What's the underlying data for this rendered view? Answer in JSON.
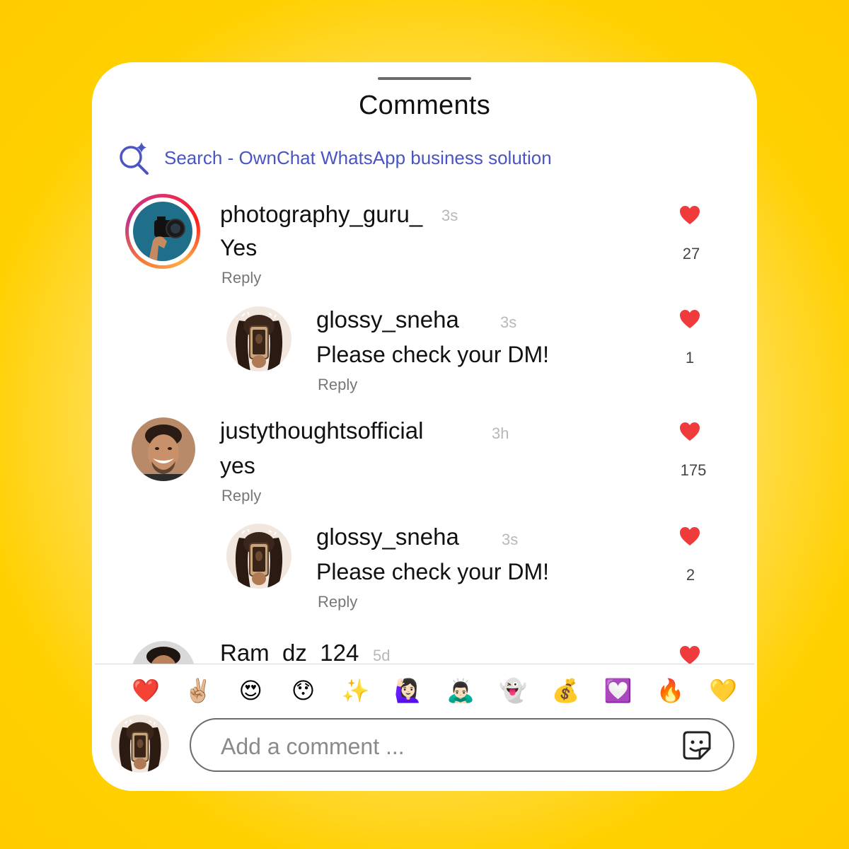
{
  "header": {
    "title": "Comments",
    "search_label": "Search - OwnChat WhatsApp business solution"
  },
  "colors": {
    "background": "#ffcc00",
    "search_accent": "#4a55c4",
    "heart": "#ef3b3b"
  },
  "comments": [
    {
      "username": "photography_guru_",
      "time": "3s",
      "text": "Yes",
      "reply_label": "Reply",
      "likes": "27",
      "avatar": "camera-hand-avatar",
      "has_story_ring": true
    },
    {
      "username": "glossy_sneha",
      "time": "3s",
      "text": "Please check your DM!",
      "reply_label": "Reply",
      "likes": "1",
      "avatar": "phone-selfie-avatar",
      "is_reply": true
    },
    {
      "username": "justythoughtsofficial",
      "time": "3h",
      "text": "yes",
      "reply_label": "Reply",
      "likes": "175",
      "avatar": "smiling-man-avatar"
    },
    {
      "username": "glossy_sneha",
      "time": "3s",
      "text": "Please check your DM!",
      "reply_label": "Reply",
      "likes": "2",
      "avatar": "phone-selfie-avatar",
      "is_reply": true
    },
    {
      "username": "Ram_dz_124",
      "time": "5d",
      "avatar": "man-avatar"
    }
  ],
  "emoji_bar": [
    "❤️",
    "✌🏼",
    "😍",
    "😯",
    "✨",
    "🙋🏻‍♀️",
    "🙇🏻‍♂️",
    "👻",
    "💰",
    "💟",
    "🔥",
    "💛"
  ],
  "composer": {
    "placeholder": "Add a comment ...",
    "sticker_icon": "sticker-icon"
  }
}
